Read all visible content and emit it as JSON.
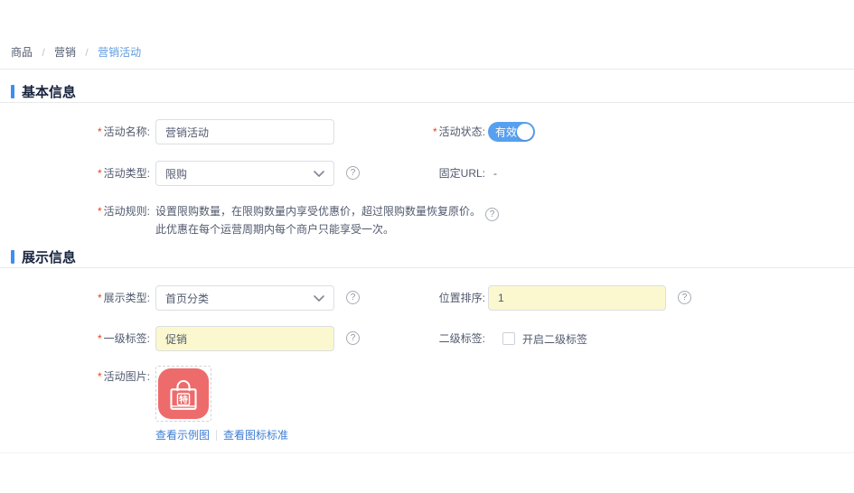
{
  "required_mark": "*",
  "icons": {
    "help": "?",
    "breadcrumb_separator": "/"
  },
  "breadcrumb": {
    "separator": "/",
    "items": [
      {
        "label": "商品"
      },
      {
        "label": "营销"
      },
      {
        "label": "营销活动"
      }
    ]
  },
  "sections": {
    "basic": {
      "title": "基本信息"
    },
    "display": {
      "title": "展示信息"
    }
  },
  "form": {
    "activity_name": {
      "label": "活动名称:",
      "required": true,
      "value": "营销活动"
    },
    "activity_status": {
      "label": "活动状态:",
      "required": true,
      "state_text": "有效",
      "state": "on"
    },
    "activity_type": {
      "label": "活动类型:",
      "required": true,
      "value": "限购"
    },
    "fixed_url": {
      "label": "固定URL:",
      "value": "-"
    },
    "activity_rule": {
      "label": "活动规则:",
      "required": true,
      "line1": "设置限购数量，在限购数量内享受优惠价，超过限购数量恢复原价。",
      "line2": "此优惠在每个运营周期内每个商户只能享受一次。"
    },
    "display_type": {
      "label": "展示类型:",
      "required": true,
      "value": "首页分类"
    },
    "position_order": {
      "label": "位置排序:",
      "value": "1"
    },
    "primary_tag": {
      "label": "一级标签:",
      "required": true,
      "value": "促销"
    },
    "secondary_tag": {
      "label": "二级标签:",
      "checkbox_label": "开启二级标签",
      "checked": false
    },
    "activity_image": {
      "label": "活动图片:",
      "required": true,
      "icon_text": "特",
      "links": [
        {
          "label": "查看示例图"
        },
        {
          "label": "查看图标标准"
        }
      ]
    }
  },
  "colors": {
    "accent_blue": "#3d8ef0",
    "link_blue": "#3d7ed6",
    "breadcrumb_active": "#5e9bdf",
    "toggle_on": "#57a0f0",
    "required_red": "#ed4014",
    "input_border": "#dcdee2",
    "divider": "#e8eaec",
    "text_primary": "#17233d",
    "text_secondary": "#515a6e",
    "highlight_yellow": "#fbf8d0",
    "icon_coral": "#ee6b6b"
  }
}
